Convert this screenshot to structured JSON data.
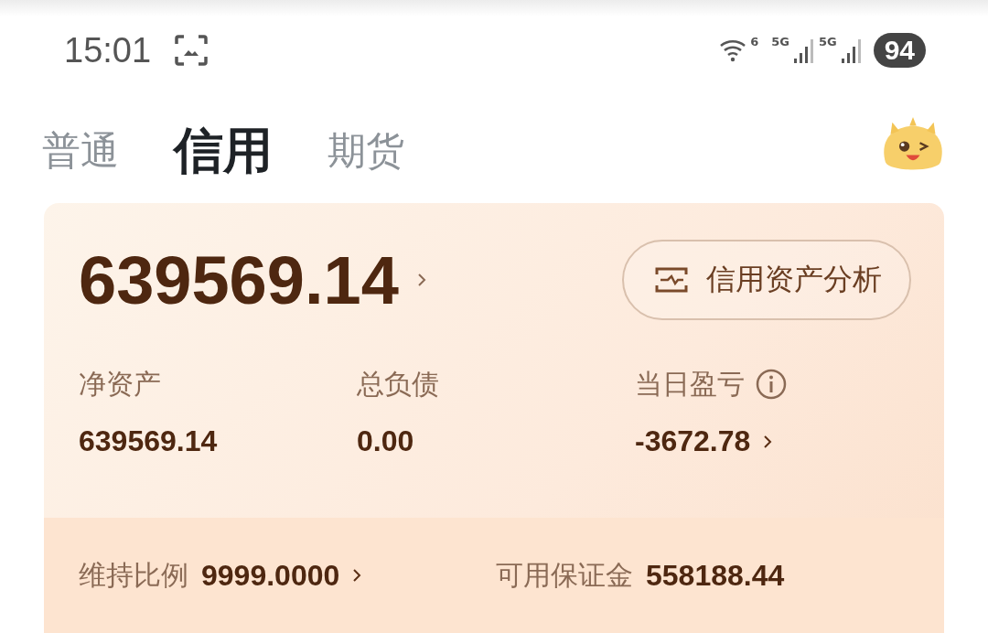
{
  "status_bar": {
    "time": "15:01",
    "wifi_label": "6",
    "sim_labels": [
      "5G",
      "5G"
    ],
    "battery": "94"
  },
  "tabs": [
    {
      "label": "普通",
      "selected": false
    },
    {
      "label": "信用",
      "selected": true
    },
    {
      "label": "期货",
      "selected": false
    }
  ],
  "card": {
    "total": "639569.14",
    "analysis_button": "信用资产分析",
    "metrics": [
      {
        "label": "净资产",
        "value": "639569.14",
        "info": false,
        "link": false
      },
      {
        "label": "总负债",
        "value": "0.00",
        "info": false,
        "link": false
      },
      {
        "label": "当日盈亏",
        "value": "-3672.78",
        "info": true,
        "link": true
      }
    ],
    "footer": [
      {
        "label": "维持比例",
        "value": "9999.0000",
        "link": true
      },
      {
        "label": "可用保证金",
        "value": "558188.44",
        "link": false
      }
    ]
  }
}
